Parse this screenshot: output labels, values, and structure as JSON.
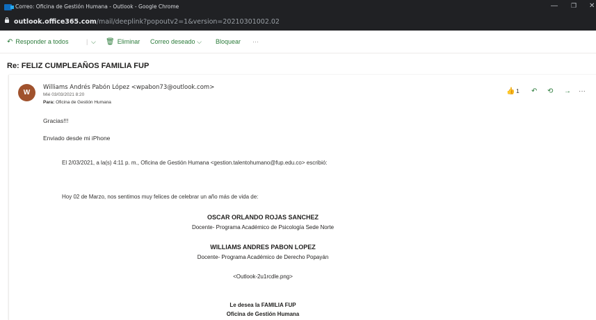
{
  "window": {
    "title": "Correo: Oficina de Gestión Humana - Outlook - Google Chrome",
    "url_host": "outlook.office365.com",
    "url_path": "/mail/deeplink?popoutv2=1&version=20210301002.02",
    "minimize": "—",
    "maximize": "❐",
    "close": "✕"
  },
  "toolbar": {
    "reply_all": "Responder a todos",
    "separator": "|",
    "chevron": "⌵",
    "delete": "Eliminar",
    "junk": "Correo deseado",
    "block": "Bloquear",
    "more": "···"
  },
  "subject": "Re: FELIZ CUMPLEAÑOS FAMILIA FUP",
  "message": {
    "avatar_initial": "W",
    "avatar_color": "#a0522d",
    "sender": "Williams Andrés Pabón López <wpabon73@outlook.com>",
    "date": "Mié 03/03/2021 8:20",
    "to_label": "Para:",
    "to_value": "Oficina de Gestión Humana",
    "like_count": "1",
    "body_line1": "Gracias!!!",
    "body_line2": "Enviado desde mi iPhone",
    "quote_header": "El 2/03/2021, a la(s) 4:11 p. m., Oficina de Gestión Humana <gestion.talentohumano@fup.edu.co> escribió:",
    "greeting": "Hoy 02 de Marzo, nos sentimos muy felices de celebrar un año más de vida de:",
    "person1_name": "OSCAR ORLANDO ROJAS SANCHEZ",
    "person1_role": "Docente- Programa Académico de Psicología Sede Norte",
    "person2_name": "WILLIAMS ANDRES PABON LOPEZ",
    "person2_role": "Docente- Programa Académico de Derecho Popayán",
    "image_placeholder": "<Outlook-2u1rcdle.png>",
    "closing1": "Le desea la FAMILIA FUP",
    "closing2": "Oficina de Gestión Humana"
  },
  "colors": {
    "accent": "#2b7b3a",
    "titlebar": "#202124"
  }
}
